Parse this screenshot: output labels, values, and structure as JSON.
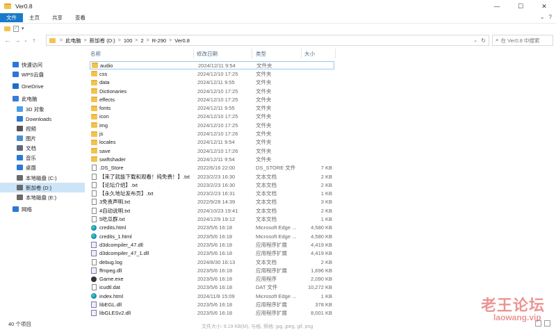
{
  "window": {
    "title": "Ver0.8",
    "controls": [
      "—",
      "☐",
      "✕"
    ]
  },
  "ribbon": {
    "tabs": [
      "文件",
      "主页",
      "共享",
      "查看"
    ],
    "right_icons": [
      "⌄",
      "?"
    ]
  },
  "qat": {
    "dropdown": "▾"
  },
  "address": {
    "nav": {
      "back": "←",
      "forward": "→",
      "recent": "⌄",
      "up": "↑"
    },
    "crumbs": [
      "此电脑",
      "新加卷 (D:)",
      "100",
      "2",
      "R-290",
      "Ver0.8"
    ],
    "separator": ">",
    "dropdown": "⌄",
    "refresh": "↻"
  },
  "search": {
    "placeholder": "在 Ver0.8 中搜索",
    "icon": "search-icon"
  },
  "nav_pane": {
    "items": [
      {
        "label": "快速访问",
        "icon": "star-icon",
        "color": "#2b78d6"
      },
      {
        "label": "WPS云盘",
        "icon": "cloud-icon",
        "color": "#2b78d6"
      },
      {
        "label": "OneDrive",
        "icon": "onedrive-icon",
        "color": "#1c6ecb"
      },
      {
        "label": "此电脑",
        "icon": "computer-icon",
        "color": "#3a7bd5"
      },
      {
        "label": "3D 对象",
        "icon": "cube-icon",
        "color": "#4aa0e8"
      },
      {
        "label": "Downloads",
        "icon": "download-icon",
        "color": "#2b78d6"
      },
      {
        "label": "视频",
        "icon": "video-icon",
        "color": "#555555"
      },
      {
        "label": "图片",
        "icon": "picture-icon",
        "color": "#4a8fd1"
      },
      {
        "label": "文档",
        "icon": "document-icon",
        "color": "#5a6b80"
      },
      {
        "label": "音乐",
        "icon": "music-icon",
        "color": "#2b78d6"
      },
      {
        "label": "桌面",
        "icon": "desktop-icon",
        "color": "#2b78d6"
      },
      {
        "label": "本地磁盘 (C:)",
        "icon": "drive-icon",
        "color": "#6a6a6a"
      },
      {
        "label": "新加卷 (D:)",
        "icon": "drive-icon",
        "color": "#6a6a6a"
      },
      {
        "label": "本地磁盘 (E:)",
        "icon": "drive-icon",
        "color": "#6a6a6a"
      },
      {
        "label": "网络",
        "icon": "network-icon",
        "color": "#2b78d6"
      }
    ],
    "selected": "新加卷 (D:)"
  },
  "columns": {
    "name": "名称",
    "date": "修改日期",
    "type": "类型",
    "size": "大小"
  },
  "files": [
    {
      "name": "audio",
      "date": "2024/12/11 9:54",
      "type": "文件夹",
      "size": "",
      "icon": "folder"
    },
    {
      "name": "css",
      "date": "2024/12/10 17:25",
      "type": "文件夹",
      "size": "",
      "icon": "folder"
    },
    {
      "name": "data",
      "date": "2024/12/11 9:55",
      "type": "文件夹",
      "size": "",
      "icon": "folder"
    },
    {
      "name": "Dictionaries",
      "date": "2024/12/10 17:25",
      "type": "文件夹",
      "size": "",
      "icon": "folder"
    },
    {
      "name": "effects",
      "date": "2024/12/10 17:25",
      "type": "文件夹",
      "size": "",
      "icon": "folder"
    },
    {
      "name": "fonts",
      "date": "2024/12/11 9:55",
      "type": "文件夹",
      "size": "",
      "icon": "folder"
    },
    {
      "name": "icon",
      "date": "2024/12/10 17:25",
      "type": "文件夹",
      "size": "",
      "icon": "folder"
    },
    {
      "name": "img",
      "date": "2024/12/10 17:25",
      "type": "文件夹",
      "size": "",
      "icon": "folder"
    },
    {
      "name": "js",
      "date": "2024/12/10 17:26",
      "type": "文件夹",
      "size": "",
      "icon": "folder"
    },
    {
      "name": "locales",
      "date": "2024/12/11 9:54",
      "type": "文件夹",
      "size": "",
      "icon": "folder"
    },
    {
      "name": "save",
      "date": "2024/12/10 17:26",
      "type": "文件夹",
      "size": "",
      "icon": "folder"
    },
    {
      "name": "swiftshader",
      "date": "2024/12/11 9:54",
      "type": "文件夹",
      "size": "",
      "icon": "folder"
    },
    {
      "name": ".DS_Store",
      "date": "2022/6/16 22:00",
      "type": "DS_STORE 文件",
      "size": "7 KB",
      "icon": "file"
    },
    {
      "name": "【来了就能下载和观看！纯免费！】.txt",
      "date": "2023/2/23 16:30",
      "type": "文本文档",
      "size": "2 KB",
      "icon": "file"
    },
    {
      "name": "【论坛介绍】.txt",
      "date": "2023/2/23 16:30",
      "type": "文本文档",
      "size": "2 KB",
      "icon": "file"
    },
    {
      "name": "【永久地址发布页】.txt",
      "date": "2023/2/23 16:31",
      "type": "文本文档",
      "size": "1 KB",
      "icon": "file"
    },
    {
      "name": "3免责声明.txt",
      "date": "2022/9/28 14:39",
      "type": "文本文档",
      "size": "3 KB",
      "icon": "file"
    },
    {
      "name": "4自动说明.txt",
      "date": "2024/10/23 19:41",
      "type": "文本文档",
      "size": "2 KB",
      "icon": "file"
    },
    {
      "name": "5吃瓜群.txt",
      "date": "2024/12/9 19:12",
      "type": "文本文档",
      "size": "1 KB",
      "icon": "file"
    },
    {
      "name": "credits.html",
      "date": "2023/5/6 16:18",
      "type": "Microsoft Edge ...",
      "size": "4,580 KB",
      "icon": "edge"
    },
    {
      "name": "credits_1.html",
      "date": "2023/5/6 16:18",
      "type": "Microsoft Edge ...",
      "size": "4,580 KB",
      "icon": "edge"
    },
    {
      "name": "d3dcompiler_47.dll",
      "date": "2023/5/6 16:18",
      "type": "应用程序扩展",
      "size": "4,419 KB",
      "icon": "dll"
    },
    {
      "name": "d3dcompiler_47_1.dll",
      "date": "2023/5/6 16:18",
      "type": "应用程序扩展",
      "size": "4,419 KB",
      "icon": "dll"
    },
    {
      "name": "debug.log",
      "date": "2024/8/30 16:13",
      "type": "文本文档",
      "size": "2 KB",
      "icon": "file"
    },
    {
      "name": "ffmpeg.dll",
      "date": "2023/5/6 16:18",
      "type": "应用程序扩展",
      "size": "1,696 KB",
      "icon": "dll"
    },
    {
      "name": "Game.exe",
      "date": "2023/5/6 16:18",
      "type": "应用程序",
      "size": "2,090 KB",
      "icon": "exe"
    },
    {
      "name": "icudtl.dat",
      "date": "2023/5/6 16:18",
      "type": "DAT 文件",
      "size": "10,272 KB",
      "icon": "file"
    },
    {
      "name": "index.html",
      "date": "2024/11/8 15:09",
      "type": "Microsoft Edge ...",
      "size": "1 KB",
      "icon": "edge"
    },
    {
      "name": "libEGL.dll",
      "date": "2023/5/6 16:18",
      "type": "应用程序扩展",
      "size": "378 KB",
      "icon": "dll"
    },
    {
      "name": "libGLESv2.dll",
      "date": "2023/5/6 16:18",
      "type": "应用程序扩展",
      "size": "8,001 KB",
      "icon": "dll"
    }
  ],
  "status": {
    "count": "40 个项目",
    "extra": "文件大小: 8.19 KB(M), 与格, 照格: jpg, jpeg, gif, png"
  },
  "watermark": {
    "text": "老王论坛",
    "url": "laowang.vip"
  }
}
